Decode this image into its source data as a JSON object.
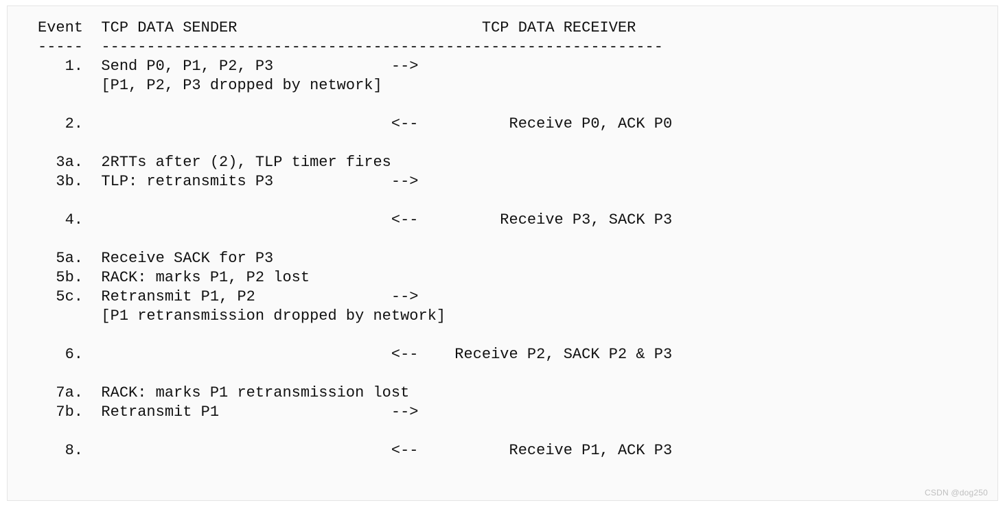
{
  "header": {
    "event_label": "Event",
    "sender_label": "TCP DATA SENDER",
    "receiver_label": "TCP DATA RECEIVER"
  },
  "divider": {
    "event_dash": "-----",
    "rest_dash": "--------------------------------------------------------------"
  },
  "rows": [
    {
      "num": "1.",
      "left": "Send P0, P1, P2, P3",
      "arrow": "-->",
      "right": ""
    },
    {
      "num": "",
      "left": "[P1, P2, P3 dropped by network]",
      "arrow": "",
      "right": ""
    },
    {
      "blank": true
    },
    {
      "num": "2.",
      "left": "",
      "arrow": "<--",
      "right": "Receive P0, ACK P0"
    },
    {
      "blank": true
    },
    {
      "num": "3a.",
      "left": "2RTTs after (2), TLP timer fires",
      "arrow": "",
      "right": ""
    },
    {
      "num": "3b.",
      "left": "TLP: retransmits P3",
      "arrow": "-->",
      "right": ""
    },
    {
      "blank": true
    },
    {
      "num": "4.",
      "left": "",
      "arrow": "<--",
      "right": "Receive P3, SACK P3"
    },
    {
      "blank": true
    },
    {
      "num": "5a.",
      "left": "Receive SACK for P3",
      "arrow": "",
      "right": ""
    },
    {
      "num": "5b.",
      "left": "RACK: marks P1, P2 lost",
      "arrow": "",
      "right": ""
    },
    {
      "num": "5c.",
      "left": "Retransmit P1, P2",
      "arrow": "-->",
      "right": ""
    },
    {
      "num": "",
      "left": "[P1 retransmission dropped by network]",
      "arrow": "",
      "right": ""
    },
    {
      "blank": true
    },
    {
      "num": "6.",
      "left": "",
      "arrow": "<--",
      "right": "Receive P2, SACK P2 & P3"
    },
    {
      "blank": true
    },
    {
      "num": "7a.",
      "left": "RACK: marks P1 retransmission lost",
      "arrow": "",
      "right": ""
    },
    {
      "num": "7b.",
      "left": "Retransmit P1",
      "arrow": "-->",
      "right": ""
    },
    {
      "blank": true
    },
    {
      "num": "8.",
      "left": "",
      "arrow": "<--",
      "right": "Receive P1, ACK P3"
    }
  ],
  "columns": {
    "num_width": 5,
    "gap1": 2,
    "left_width": 30,
    "gap2": 2,
    "arrow_width": 3,
    "gap3": 4,
    "right_pad_width": 24
  },
  "watermark": "CSDN @dog250"
}
